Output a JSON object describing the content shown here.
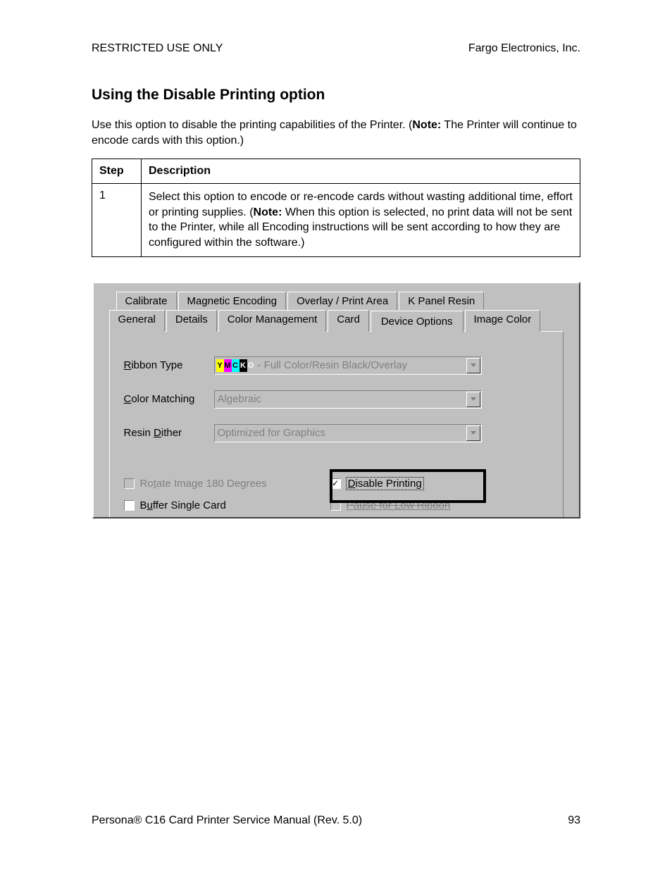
{
  "header": {
    "left": "RESTRICTED USE ONLY",
    "right": "Fargo Electronics, Inc."
  },
  "title": "Using the Disable Printing option",
  "intro_pre": "Use this option to disable the printing capabilities of the Printer. (",
  "intro_bold": "Note:",
  "intro_post": "  The Printer will continue to encode cards with this option.)",
  "table": {
    "headers": {
      "step": "Step",
      "desc": "Description"
    },
    "row1": {
      "step": "1",
      "d1": "Select this option to encode or re-encode cards without wasting additional time, effort or printing supplies. (",
      "d_bold": "Note:",
      "d2": "  When this option is selected, no print data will not be sent to the Printer, while all Encoding instructions will be sent according to how they are configured within the software.)"
    }
  },
  "dialog": {
    "tabs_top": [
      "Calibrate",
      "Magnetic Encoding",
      "Overlay / Print Area",
      "K Panel Resin"
    ],
    "tabs_bottom": [
      "General",
      "Details",
      "Color Management",
      "Card",
      "Device Options",
      "Image Color"
    ],
    "labels": {
      "ribbon_r": "R",
      "ribbon_rest": "ibbon Type",
      "color_c": "C",
      "color_rest": "olor Matching",
      "dither_pre": "Resin ",
      "dither_d": "D",
      "dither_post": "ither"
    },
    "combos": {
      "ribbon_suffix": " - Full Color/Resin Black/Overlay",
      "color_matching": "Algebraic",
      "resin_dither": "Optimized for Graphics"
    },
    "ribbon_letters": {
      "y": "Y",
      "m": "M",
      "c": "C",
      "k": "K",
      "o": "O"
    },
    "checks": {
      "rotate_pre": "Ro",
      "rotate_t": "t",
      "rotate_post": "ate Image 180 Degrees",
      "buffer_pre": "B",
      "buffer_u": "u",
      "buffer_post": "ffer Single Card",
      "disable_d": "D",
      "disable_post": "isable Printing",
      "pause": "Pause for Low Ribbon"
    }
  },
  "footer": {
    "left": "Persona® C16 Card Printer Service Manual (Rev. 5.0)",
    "right": "93"
  }
}
